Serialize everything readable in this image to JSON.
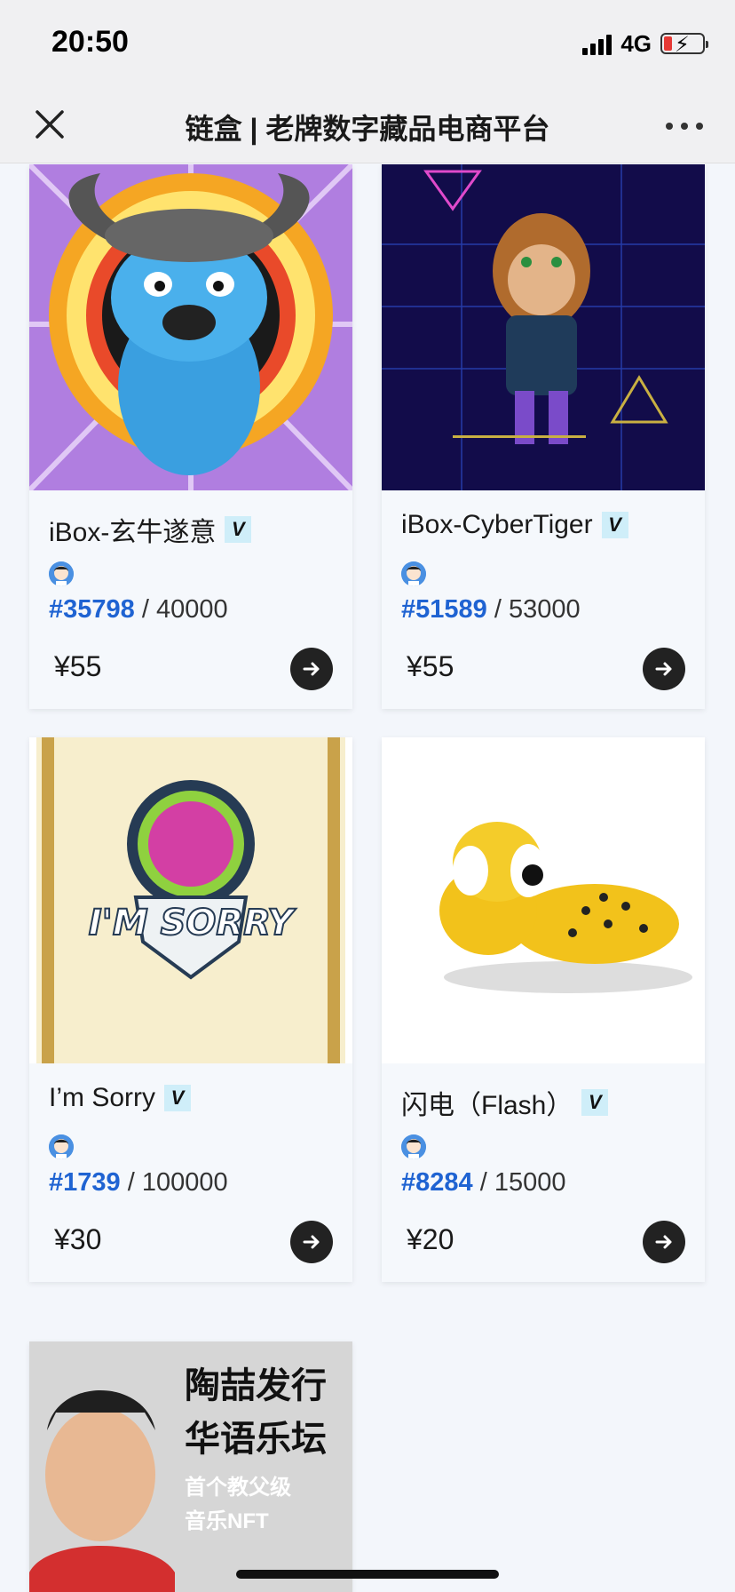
{
  "status_bar": {
    "time": "20:50",
    "network": "4G"
  },
  "nav": {
    "title": "链盒 | 老牌数字藏品电商平台"
  },
  "cards": [
    {
      "title": "iBox-玄牛遂意",
      "serial": "#35798",
      "total": "/ 40000",
      "price": "¥55"
    },
    {
      "title": "iBox-CyberTiger",
      "serial": "#51589",
      "total": "/ 53000",
      "price": "¥55"
    },
    {
      "title": "I’m Sorry",
      "serial": "#1739",
      "total": "/ 100000",
      "price": "¥30"
    },
    {
      "title": "闪电（Flash）",
      "serial": "#8284",
      "total": "/ 15000",
      "price": "¥20"
    }
  ],
  "promo": {
    "line1": "陶喆发行",
    "line2": "华语乐坛",
    "line3": "首个教父级",
    "line4": "音乐NFT"
  },
  "colors": {
    "serial_blue": "#1f63d2",
    "badge_bg": "#cfeef9",
    "page_bg": "#f3f6fb"
  }
}
